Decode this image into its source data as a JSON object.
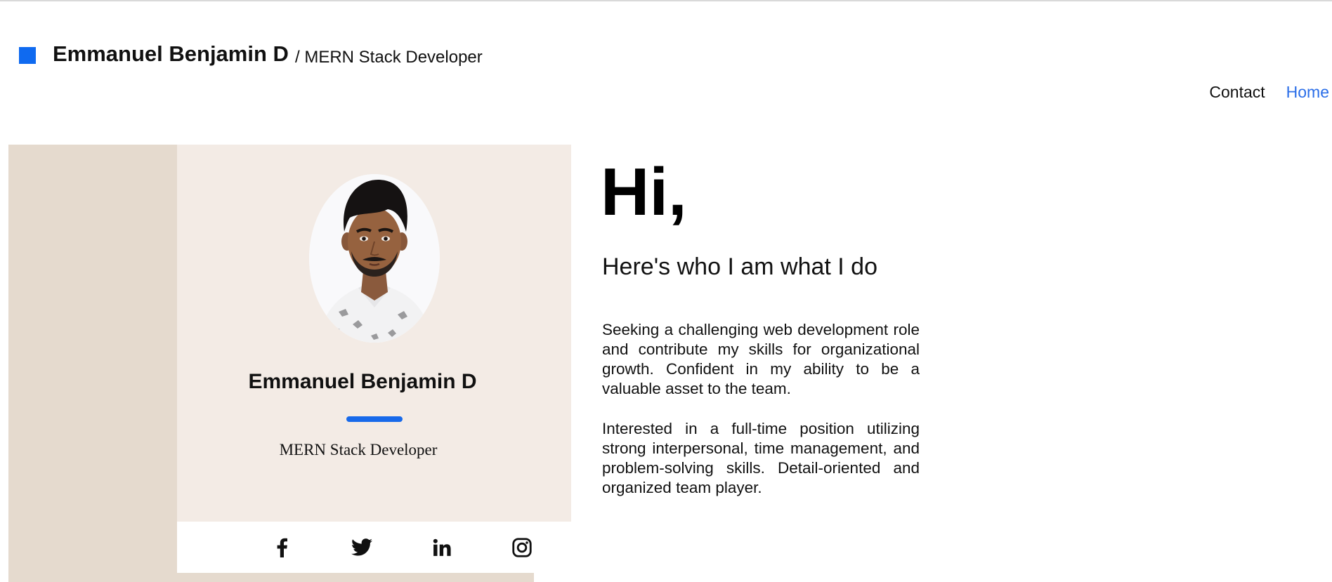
{
  "header": {
    "name": "Emmanuel Benjamin D",
    "tagline": "/ MERN Stack Developer",
    "accent_color": "#0f6af0"
  },
  "nav": {
    "items": [
      {
        "label": "Contact",
        "active": false
      },
      {
        "label": "Home",
        "active": true
      }
    ]
  },
  "profile_card": {
    "photo_icon": "portrait-photo",
    "name": "Emmanuel Benjamin D",
    "role": "MERN Stack Developer",
    "background_color": "#f3ebe5",
    "backdrop_color": "#e5dace",
    "social": [
      {
        "icon": "facebook-icon"
      },
      {
        "icon": "twitter-icon"
      },
      {
        "icon": "linkedin-icon"
      },
      {
        "icon": "instagram-icon"
      }
    ]
  },
  "hero": {
    "greeting": "Hi,",
    "subtitle": "Here's who I am what I do",
    "paragraphs": [
      "Seeking a challenging web development role and contribute my skills for organizational growth. Confident in my ability to be a valuable asset to the team.",
      "Interested in a full-time position utilizing strong interpersonal, time management, and problem-solving skills. Detail-oriented and organized team player."
    ]
  }
}
